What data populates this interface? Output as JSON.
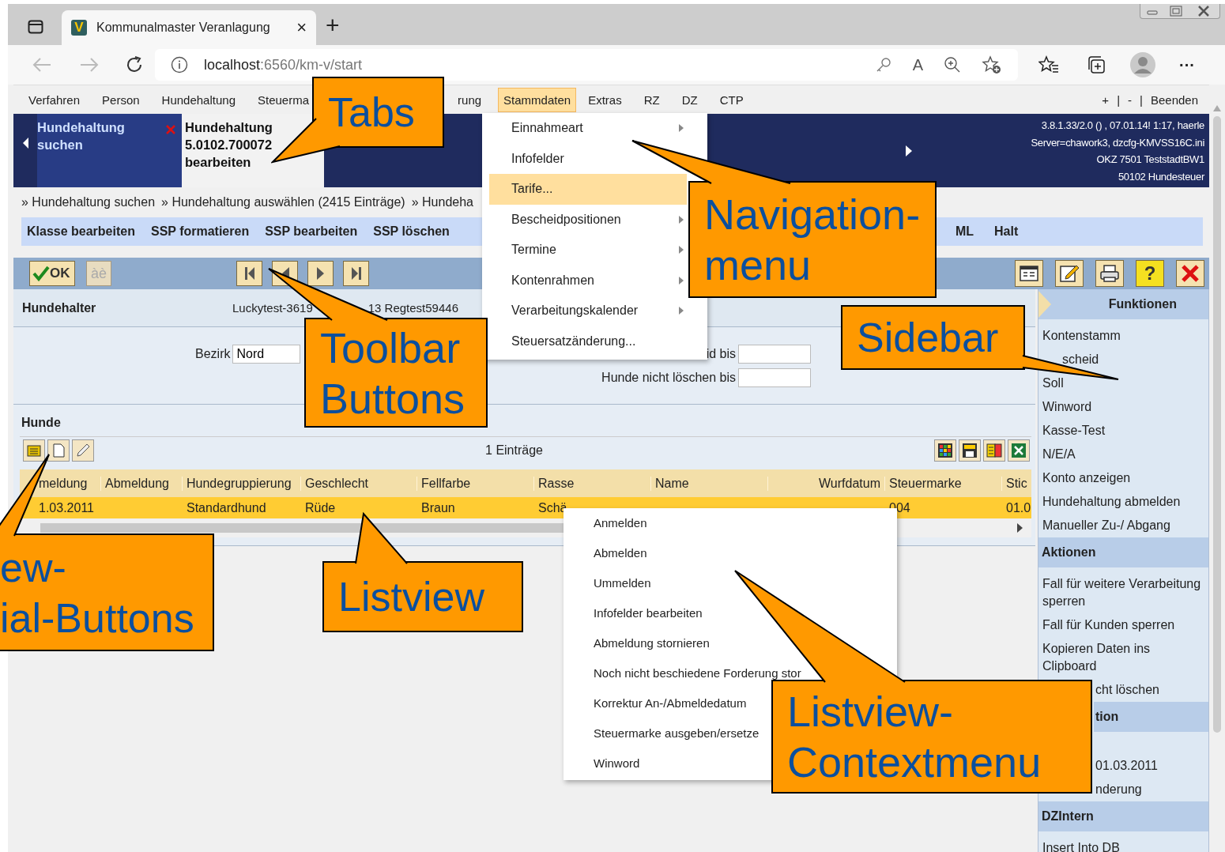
{
  "browser": {
    "logo_letter": "V",
    "tab_title": "Kommunalmaster Veranlagung",
    "tab_close": "×",
    "new_tab": "+",
    "address_host": "localhost",
    "address_path": ":6560/km-v/start",
    "read_aloud_glyph": "A",
    "more": "···"
  },
  "menubar": {
    "items": [
      {
        "label": "Verfahren",
        "selected": false
      },
      {
        "label": "Person",
        "selected": false
      },
      {
        "label": "Hundehaltung",
        "selected": false
      },
      {
        "label": "Steuerma",
        "selected": false
      },
      {
        "label": "rung",
        "selected": false
      },
      {
        "label": "Stammdaten",
        "selected": true
      },
      {
        "label": "Extras",
        "selected": false
      },
      {
        "label": "RZ",
        "selected": false
      },
      {
        "label": "DZ",
        "selected": false
      },
      {
        "label": "CTP",
        "selected": false
      }
    ],
    "right": [
      "+",
      "|",
      "-",
      "|",
      "Beenden"
    ]
  },
  "doc_tabs": [
    {
      "label": "Hundehaltung suchen",
      "selected": false,
      "closable": true
    },
    {
      "label": "Hundehaltung 5.0102.700072 bearbeiten",
      "selected": true,
      "closable": false
    }
  ],
  "session_info": [
    "3.8.1.33/2.0 () , 07.01.14! 1:17, haerle",
    "Server=chawork3, dzcfg-KMVSS16C.ini",
    "OKZ 7501 TeststadtBW1",
    "50102 Hundesteuer"
  ],
  "breadcrumb": [
    "» Hundehaltung suchen",
    "» Hundehaltung auswählen (2415 Einträge)",
    "» Hundeha"
  ],
  "actions": [
    "Klasse bearbeiten",
    "SSP formatieren",
    "SSP bearbeiten",
    "SSP löschen",
    "ML",
    "Halt"
  ],
  "toolbar": {
    "ok_label": "OK",
    "accent_label": "àè",
    "accent_disabled": true,
    "help_glyph": "?"
  },
  "holder": {
    "label": "Hundehalter",
    "value_parts": [
      "Luckytest-3619",
      "13 Regtest59446"
    ]
  },
  "form": {
    "fields": [
      {
        "label": "Bezirk",
        "value": "Nord"
      },
      {
        "label": "id bis"
      },
      {
        "label": "Hunde nicht löschen bis"
      }
    ]
  },
  "dogs": {
    "title": "Hunde",
    "count": "1 Einträge",
    "columns": [
      "meldung",
      "Abmeldung",
      "Hundegruppierung",
      "Geschlecht",
      "Fellfarbe",
      "Rasse",
      "Name",
      "Wurfdatum",
      "Steuermarke",
      "Stic"
    ],
    "rows": [
      {
        "selected": true,
        "cells": [
          "1.03.2011",
          null,
          "Standardhund",
          "Rüde",
          "Braun",
          "Schä",
          null,
          null,
          "004",
          "01.0"
        ]
      }
    ]
  },
  "sidebar": {
    "sections": [
      {
        "title": "Funktionen",
        "items": [
          "Kontenstamm",
          "scheid",
          "Soll",
          "Winword",
          "Kasse-Test",
          "N/E/A",
          "Konto anzeigen",
          "Hundehaltung abmelden",
          "Manueller Zu-/ Abgang"
        ]
      },
      {
        "title": "Aktionen",
        "items": [
          "Fall für weitere Verarbeitung sperren",
          "Fall für Kunden sperren",
          "Kopieren Daten ins Clipboard",
          "cht löschen"
        ]
      },
      {
        "title": "tion",
        "items": [
          "01.03.2011",
          "nderung"
        ]
      },
      {
        "title": "DZIntern",
        "items": [
          "Insert Into DB"
        ]
      }
    ]
  },
  "nav_menu": {
    "items": [
      {
        "label": "Einnahmeart",
        "submenu": true,
        "selected": false
      },
      {
        "label": "Infofelder",
        "selected": false
      },
      {
        "label": "Tarife...",
        "selected": true
      },
      {
        "label": "Bescheidpositionen",
        "submenu": true,
        "selected": false
      },
      {
        "label": "Termine",
        "submenu": true,
        "selected": false
      },
      {
        "label": "Kontenrahmen",
        "submenu": true,
        "selected": false
      },
      {
        "label": "Verarbeitungskalender",
        "submenu": true,
        "selected": false
      },
      {
        "label": "Steuersatzänderung...",
        "submenu": false,
        "selected": false
      }
    ]
  },
  "context_menu": {
    "items": [
      "Anmelden",
      "Abmelden",
      "Ummelden",
      "Infofelder bearbeiten",
      "Abmeldung stornieren",
      "Noch nicht beschiedene Forderung stor",
      "Korrektur An-/Abmeldedatum",
      "Steuermarke ausgeben/ersetze",
      "Winword"
    ]
  },
  "callouts": [
    {
      "lines": [
        "Tabs"
      ]
    },
    {
      "lines": [
        "Navigation-",
        "menu"
      ]
    },
    {
      "lines": [
        "Toolbar",
        "Buttons"
      ]
    },
    {
      "lines": [
        "Sidebar"
      ]
    },
    {
      "lines": [
        "Listview"
      ]
    },
    {
      "lines": [
        "Listview-",
        "Contextmenu"
      ]
    },
    {
      "lines": [
        "ew-",
        "ial-Buttons"
      ]
    }
  ]
}
